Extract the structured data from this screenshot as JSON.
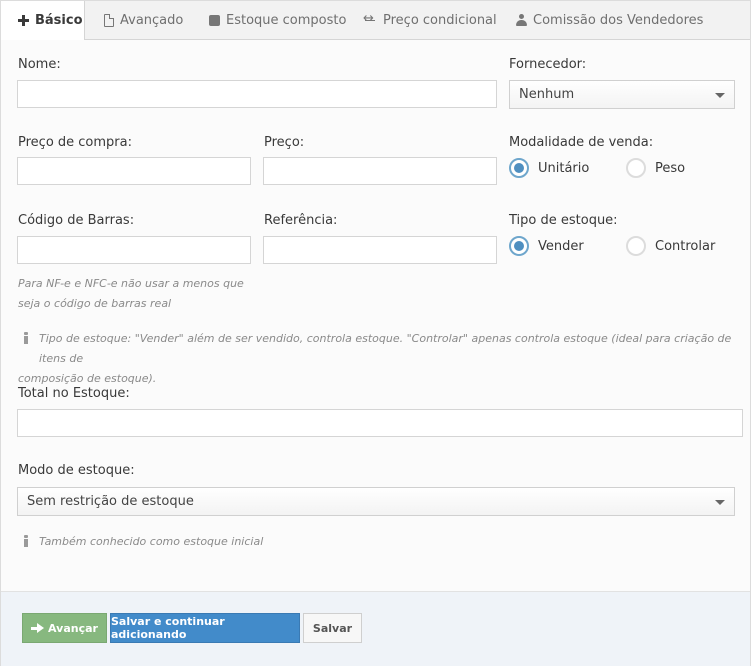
{
  "tabs": [
    {
      "label": "Básico",
      "icon": "plus-icon",
      "active": true
    },
    {
      "label": "Avançado",
      "icon": "file-icon"
    },
    {
      "label": "Estoque composto",
      "icon": "square-icon"
    },
    {
      "label": "Preço condicional",
      "icon": "arrows-h-icon"
    },
    {
      "label": "Comissão dos Vendedores",
      "icon": "user-icon"
    }
  ],
  "form": {
    "nome_label": "Nome:",
    "fornecedor_label": "Fornecedor:",
    "fornecedor_value": "Nenhum",
    "preco_compra_label": "Preço de compra:",
    "preco_label": "Preço:",
    "modalidade_label": "Modalidade de venda:",
    "modalidade_options": [
      "Unitário",
      "Peso"
    ],
    "codigo_barras_label": "Código de Barras:",
    "referencia_label": "Referência:",
    "tipo_estoque_label": "Tipo de estoque:",
    "tipo_estoque_options": [
      "Vender",
      "Controlar"
    ],
    "codigo_barras_help_line1": "Para NF-e e NFC-e não usar a menos que",
    "codigo_barras_help_line2": "seja o código de barras real",
    "tipo_estoque_info_line1": "Tipo de estoque: \"Vender\" além de ser vendido, controla estoque. \"Controlar\" apenas controla estoque (ideal para criação de itens de",
    "tipo_estoque_info_line2": "composição de estoque).",
    "total_estoque_label": "Total no Estoque:",
    "modo_estoque_label": "Modo de estoque:",
    "modo_estoque_value": "Sem restrição de estoque",
    "total_estoque_info": "Também conhecido como estoque inicial"
  },
  "footer": {
    "avancar_label": "Avançar",
    "salvar_continuar_label": "Salvar e continuar adicionando",
    "salvar_label": "Salvar"
  },
  "colors": {
    "success": "#87b87f",
    "primary": "#428bca",
    "radio_accent": "#4f8fc0"
  }
}
